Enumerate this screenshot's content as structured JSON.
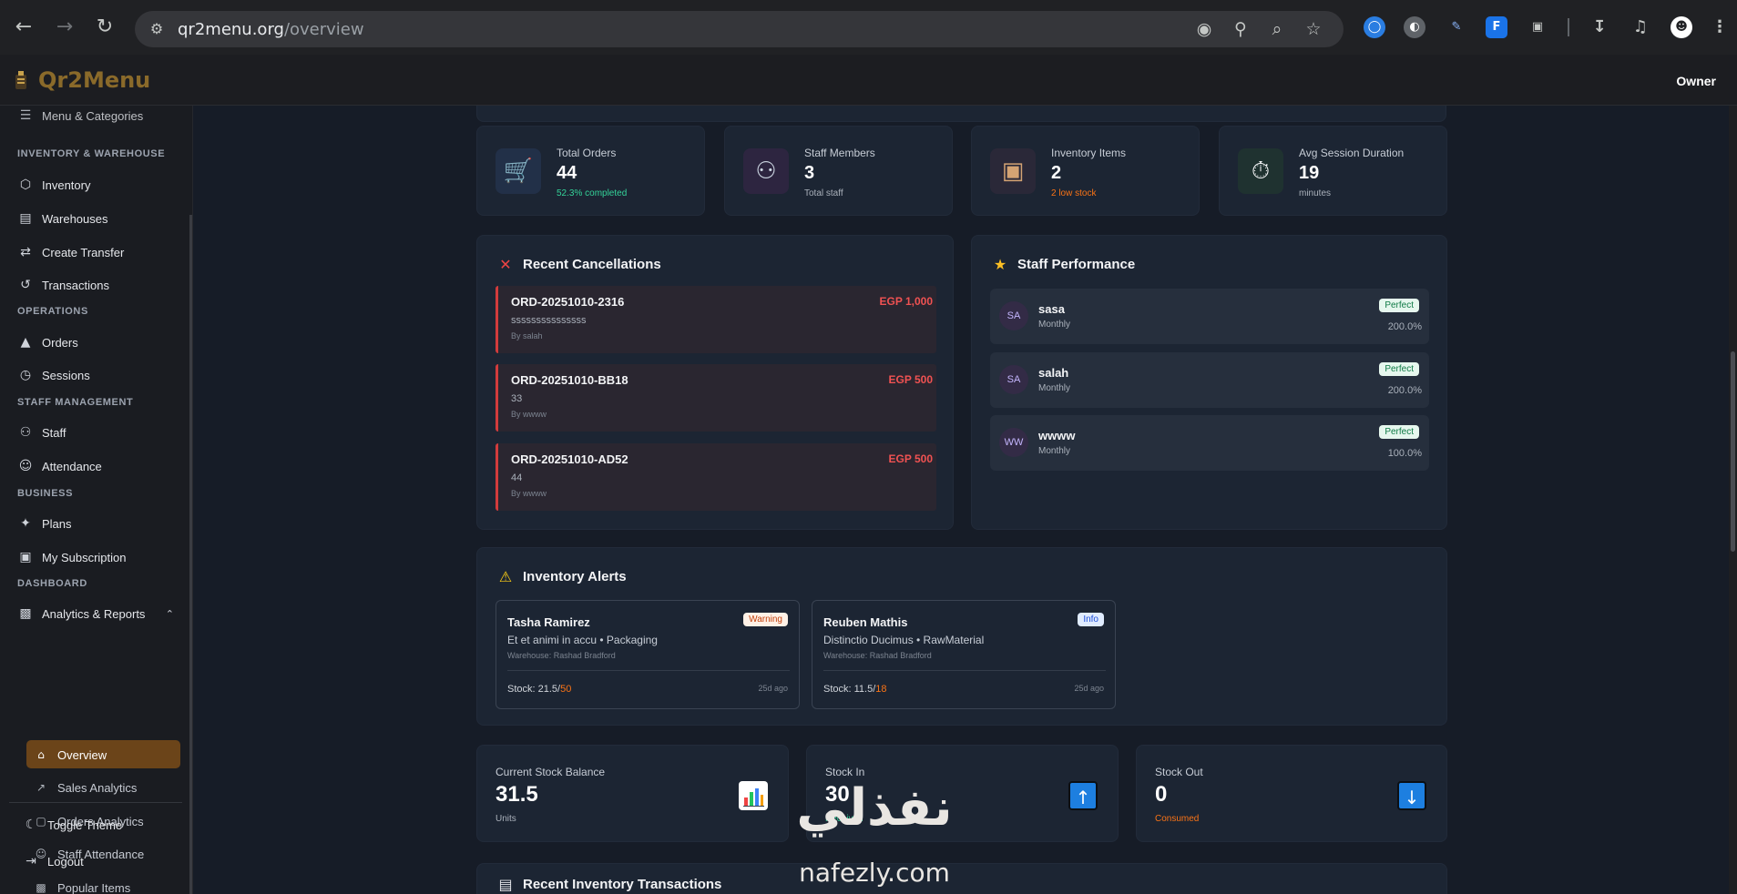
{
  "browser": {
    "url_host": "qr2menu.org",
    "url_path": "/overview"
  },
  "header": {
    "brand": "Qr2Menu",
    "user_role": "Owner"
  },
  "sidebar": {
    "partial_item": "Menu & Categories",
    "sections": {
      "inventory": "INVENTORY & WAREHOUSE",
      "operations": "OPERATIONS",
      "staff": "STAFF MANAGEMENT",
      "business": "BUSINESS",
      "dashboard": "DASHBOARD"
    },
    "items": {
      "inventory": "Inventory",
      "warehouses": "Warehouses",
      "create_transfer": "Create Transfer",
      "transactions": "Transactions",
      "orders": "Orders",
      "sessions": "Sessions",
      "staff": "Staff",
      "attendance": "Attendance",
      "plans": "Plans",
      "my_subscription": "My Subscription",
      "analytics_reports": "Analytics & Reports"
    },
    "sub_items": {
      "overview": "Overview",
      "sales_analytics": "Sales Analytics",
      "orders_analytics": "Orders Analytics",
      "staff_attendance": "Staff Attendance",
      "popular_items": "Popular Items"
    },
    "toggle_theme": "Toggle Theme",
    "logout": "Logout"
  },
  "stats": [
    {
      "label": "Total Orders",
      "value": "44",
      "sub": "52.3% completed",
      "icon": "cart-icon",
      "sub_color": "#34d399"
    },
    {
      "label": "Staff Members",
      "value": "3",
      "sub": "Total staff",
      "icon": "people-icon",
      "sub_color": "#aab1bb"
    },
    {
      "label": "Inventory Items",
      "value": "2",
      "sub": "2 low stock",
      "icon": "package-icon",
      "sub_color": "#f97316"
    },
    {
      "label": "Avg Session Duration",
      "value": "19",
      "sub": "minutes",
      "icon": "stopwatch-icon",
      "sub_color": "#aab1bb"
    }
  ],
  "cancellations": {
    "title": "Recent Cancellations",
    "items": [
      {
        "order_id": "ORD-20251010-2316",
        "amount": "EGP 1,000",
        "reason": "sssssssssssssss",
        "by": "By salah"
      },
      {
        "order_id": "ORD-20251010-BB18",
        "amount": "EGP 500",
        "reason": "33",
        "by": "By wwww"
      },
      {
        "order_id": "ORD-20251010-AD52",
        "amount": "EGP 500",
        "reason": "44",
        "by": "By wwww"
      }
    ]
  },
  "performance": {
    "title": "Staff Performance",
    "items": [
      {
        "initials": "SA",
        "name": "sasa",
        "period": "Monthly",
        "badge": "Perfect",
        "percent": "200.0%"
      },
      {
        "initials": "SA",
        "name": "salah",
        "period": "Monthly",
        "badge": "Perfect",
        "percent": "200.0%"
      },
      {
        "initials": "WW",
        "name": "wwww",
        "period": "Monthly",
        "badge": "Perfect",
        "percent": "100.0%"
      }
    ]
  },
  "alerts": {
    "title": "Inventory Alerts",
    "items": [
      {
        "name": "Tasha Ramirez",
        "tag": "Warning",
        "desc": "Et et animi in accu • Packaging",
        "warehouse": "Warehouse: Rashad Bradford",
        "stock_label": "Stock: ",
        "stock": "21.5",
        "threshold": "50",
        "ago": "25d ago"
      },
      {
        "name": "Reuben Mathis",
        "tag": "Info",
        "desc": "Distinctio Ducimus • RawMaterial",
        "warehouse": "Warehouse: Rashad Bradford",
        "stock_label": "Stock: ",
        "stock": "11.5",
        "threshold": "18",
        "ago": "25d ago"
      }
    ]
  },
  "balances": [
    {
      "label": "Current Stock Balance",
      "value": "31.5",
      "sub": "Units",
      "icon": "bar-chart-icon"
    },
    {
      "label": "Stock In",
      "value": "30",
      "sub": "Received",
      "icon": "arrow-up-icon"
    },
    {
      "label": "Stock Out",
      "value": "0",
      "sub": "Consumed",
      "icon": "arrow-down-icon"
    }
  ],
  "transactions_title": "Recent Inventory Transactions",
  "watermark": {
    "arabic": "نفذلي",
    "latin": "nafezly.com"
  },
  "colors": {
    "accent": "#8a6a2a",
    "active_item": "#6b4419",
    "danger": "#f05252",
    "success": "#34d399",
    "warning": "#f97316"
  }
}
